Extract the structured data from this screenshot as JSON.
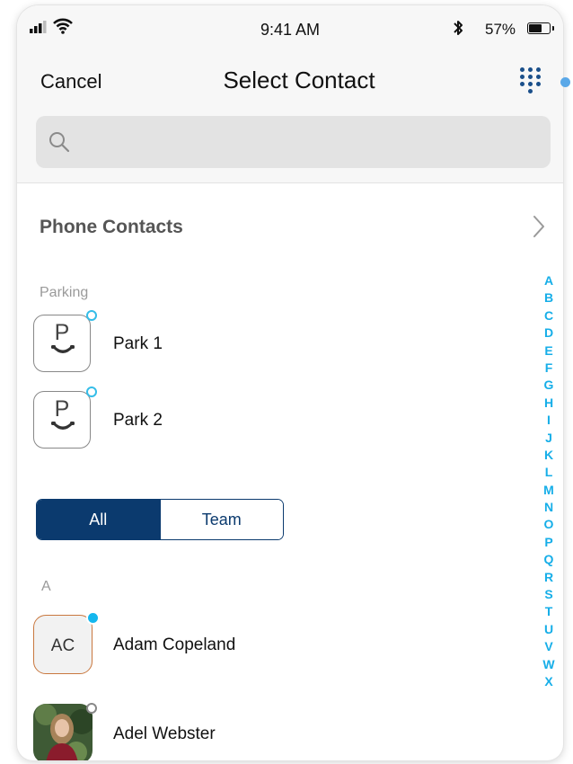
{
  "status_bar": {
    "time": "9:41 AM",
    "battery": "57%",
    "battery_level": 0.57
  },
  "nav": {
    "cancel_label": "Cancel",
    "title": "Select Contact"
  },
  "search": {
    "placeholder": "",
    "value": ""
  },
  "phone_contacts": {
    "label": "Phone Contacts"
  },
  "parking": {
    "header": "Parking",
    "items": [
      {
        "letter": "P",
        "name": "Park 1"
      },
      {
        "letter": "P",
        "name": "Park 2"
      }
    ]
  },
  "segment": {
    "options": [
      "All",
      "Team"
    ],
    "selected": "All"
  },
  "contacts": {
    "section_a": "A",
    "items": [
      {
        "initials": "AC",
        "name": "Adam Copeland",
        "status": "online"
      },
      {
        "initials": "",
        "name": "Adel Webster",
        "status": "offline"
      }
    ]
  },
  "alphabet": [
    "A",
    "B",
    "C",
    "D",
    "E",
    "F",
    "G",
    "H",
    "I",
    "J",
    "K",
    "L",
    "M",
    "N",
    "O",
    "P",
    "Q",
    "R",
    "S",
    "T",
    "U",
    "V",
    "W",
    "X"
  ],
  "colors": {
    "accent": "#16aee8",
    "navy": "#0b3a6e",
    "dialpad": "#1a4f8a"
  },
  "icons": [
    "signal-icon",
    "wifi-icon",
    "bluetooth-icon",
    "battery-icon",
    "dialpad-icon",
    "search-icon",
    "chevron-right-icon",
    "parking-phone-icon"
  ]
}
